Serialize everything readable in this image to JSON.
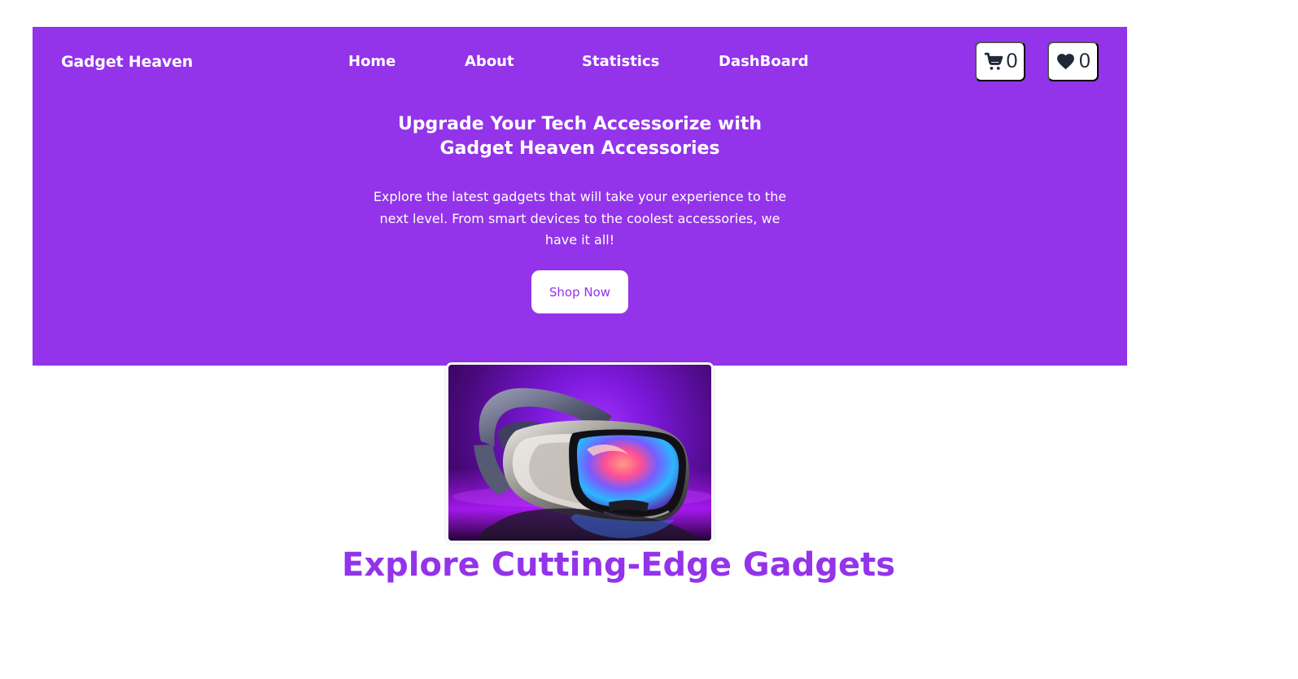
{
  "navbar": {
    "brand": "Gadget Heaven",
    "links": [
      {
        "label": "Home"
      },
      {
        "label": "About"
      },
      {
        "label": "Statistics"
      },
      {
        "label": "DashBoard"
      }
    ],
    "cart": {
      "icon": "cart-icon",
      "count": "0"
    },
    "wishlist": {
      "icon": "heart-icon",
      "count": "0"
    }
  },
  "hero": {
    "title": "Upgrade Your Tech Accessorize with Gadget Heaven Accessories",
    "subtitle": "Explore the latest gadgets that will take your experience to the next level. From smart devices to the coolest accessories, we have it all!",
    "cta_label": "Shop Now",
    "image_icon": "vr-headset-image"
  },
  "section": {
    "heading": "Explore Cutting-Edge Gadgets"
  },
  "colors": {
    "brand_purple": "#9333ea",
    "white": "#ffffff",
    "dark_icon": "#1f2937"
  }
}
